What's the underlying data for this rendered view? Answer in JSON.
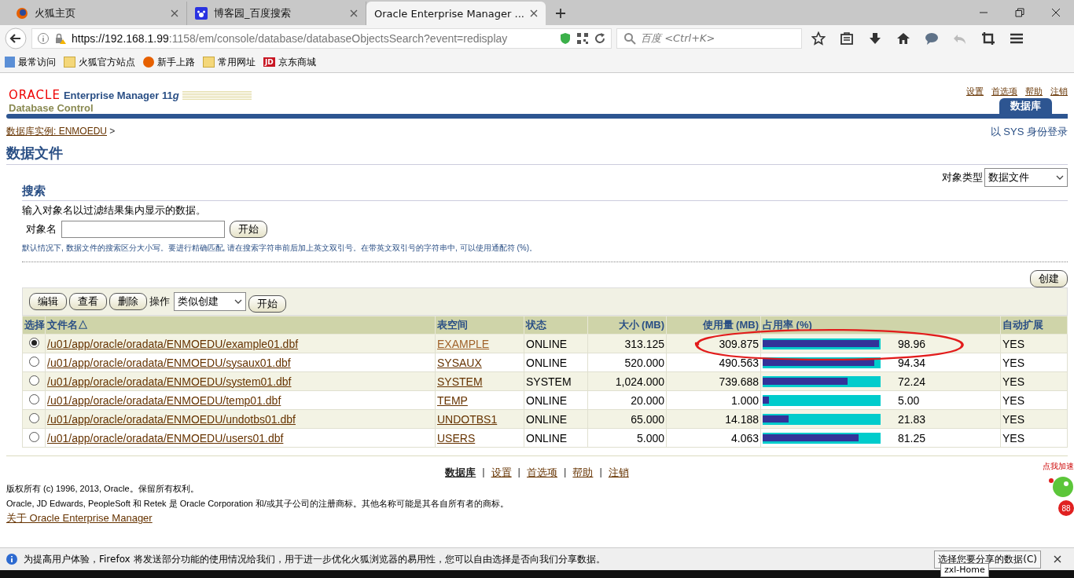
{
  "browser": {
    "tabs": [
      {
        "label": "火狐主页",
        "selected": false,
        "kind": "firefox"
      },
      {
        "label": "博客园_百度搜索",
        "selected": false,
        "kind": "paw"
      },
      {
        "label": "Oracle Enterprise Manager ...",
        "selected": true,
        "kind": "plain"
      }
    ],
    "url_host": "https://192.168.1.99",
    "url_rest": ":1158/em/console/database/databaseObjectsSearch?event=redisplay",
    "search_placeholder": "百度 <Ctrl+K>",
    "bookmarks": [
      {
        "label": "最常访问",
        "kind": "page"
      },
      {
        "label": "火狐官方站点",
        "kind": "folder"
      },
      {
        "label": "新手上路",
        "kind": "firefox"
      },
      {
        "label": "常用网址",
        "kind": "folder"
      },
      {
        "label": "京东商城",
        "kind": "badge",
        "badge": "JD"
      }
    ]
  },
  "header": {
    "brand": "ORACLE",
    "product": "Enterprise Manager 11",
    "product_suffix": "g",
    "subtitle": "Database Control",
    "links": [
      "设置",
      "首选项",
      "帮助",
      "注销"
    ],
    "tab": "数据库"
  },
  "breadcrumb": {
    "link": "数据库实例: ENMOEDU",
    "sep": ">"
  },
  "login_as": "以 SYS 身份登录",
  "title": "数据文件",
  "object_type": {
    "label": "对象类型",
    "value": "数据文件"
  },
  "search": {
    "heading": "搜索",
    "intro": "输入对象名以过滤结果集内显示的数据。",
    "label": "对象名",
    "button": "开始",
    "hint": "默认情况下, 数据文件的搜索区分大小写。要进行精确匹配, 请在搜索字符串前后加上英文双引号。在带英文双引号的字符串中, 可以使用通配符 (%)。"
  },
  "create_button": "创建",
  "toolbar": {
    "buttons": [
      "编辑",
      "查看",
      "删除"
    ],
    "action_label": "操作",
    "action_value": "类似创建",
    "go": "开始"
  },
  "table": {
    "columns": [
      "选择",
      "文件名",
      "表空间",
      "状态",
      "大小 (MB)",
      "使用量 (MB)",
      "占用率 (%)",
      "自动扩展"
    ],
    "sort_mark": "△",
    "rows": [
      {
        "selected": true,
        "file": "/u01/app/oracle/oradata/ENMOEDU/example01.dbf",
        "tablespace": "EXAMPLE",
        "status": "ONLINE",
        "size": "313.125",
        "used": "309.875",
        "level": 0.9896,
        "pct": "98.96",
        "autoextend": "YES"
      },
      {
        "selected": false,
        "file": "/u01/app/oracle/oradata/ENMOEDU/sysaux01.dbf",
        "tablespace": "SYSAUX",
        "status": "ONLINE",
        "size": "520.000",
        "used": "490.563",
        "level": 0.9434,
        "pct": "94.34",
        "autoextend": "YES"
      },
      {
        "selected": false,
        "file": "/u01/app/oracle/oradata/ENMOEDU/system01.dbf",
        "tablespace": "SYSTEM",
        "status": "SYSTEM",
        "size": "1,024.000",
        "used": "739.688",
        "level": 0.7224,
        "pct": "72.24",
        "autoextend": "YES"
      },
      {
        "selected": false,
        "file": "/u01/app/oracle/oradata/ENMOEDU/temp01.dbf",
        "tablespace": "TEMP",
        "status": "ONLINE",
        "size": "20.000",
        "used": "1.000",
        "level": 0.05,
        "pct": "5.00",
        "autoextend": "YES"
      },
      {
        "selected": false,
        "file": "/u01/app/oracle/oradata/ENMOEDU/undotbs01.dbf",
        "tablespace": "UNDOTBS1",
        "status": "ONLINE",
        "size": "65.000",
        "used": "14.188",
        "level": 0.2183,
        "pct": "21.83",
        "autoextend": "YES"
      },
      {
        "selected": false,
        "file": "/u01/app/oracle/oradata/ENMOEDU/users01.dbf",
        "tablespace": "USERS",
        "status": "ONLINE",
        "size": "5.000",
        "used": "4.063",
        "level": 0.8125,
        "pct": "81.25",
        "autoextend": "YES"
      }
    ]
  },
  "footer": {
    "separator": "|",
    "links": [
      {
        "label": "数据库",
        "selected": true
      },
      {
        "label": "设置",
        "selected": false
      },
      {
        "label": "首选项",
        "selected": false
      },
      {
        "label": "帮助",
        "selected": false
      },
      {
        "label": "注销",
        "selected": false
      }
    ],
    "copyright": "版权所有 (c) 1996, 2013, Oracle。保留所有权利。",
    "trademark": "Oracle, JD Edwards, PeopleSoft 和 Retek 是 Oracle Corporation 和/或其子公司的注册商标。其他名称可能是其各自所有者的商标。",
    "about": "关于 Oracle Enterprise Manager"
  },
  "widget": {
    "label": "点我加速",
    "count": "88"
  },
  "notification": {
    "text": "为提高用户体验，Firefox 将发送部分功能的使用情况给我们，用于进一步优化火狐浏览器的易用性，您可以自由选择是否向我们分享数据。",
    "button": "选择您要分享的数据(C)"
  },
  "tooltip": "zxl-Home"
}
